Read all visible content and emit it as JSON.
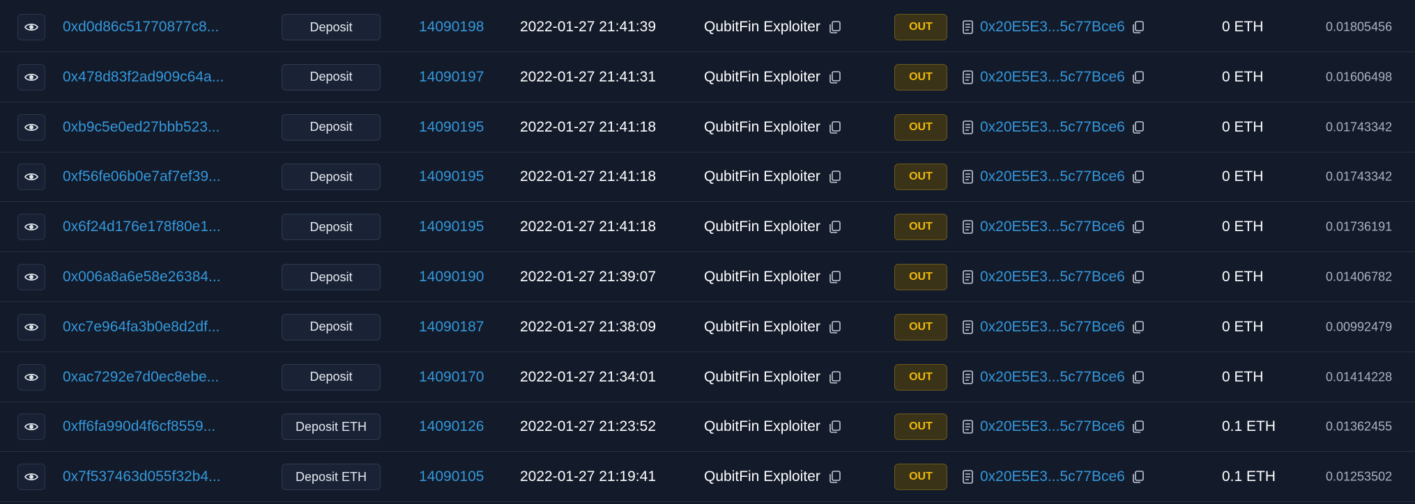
{
  "icons": {
    "view": "eye-icon",
    "copy": "copy-icon",
    "contract": "document-icon"
  },
  "colors": {
    "background": "#131a2a",
    "link": "#3498db",
    "out_badge_text": "#f0b90b",
    "out_badge_bg": "#3a3318"
  },
  "transactions": [
    {
      "hash": "0xd0d86c51770877c8...",
      "method": "Deposit",
      "block": "14090198",
      "age": "2022-01-27 21:41:39",
      "from": "QubitFin Exploiter",
      "direction": "OUT",
      "to": "0x20E5E3...5c77Bce6",
      "value": "0 ETH",
      "fee": "0.01805456"
    },
    {
      "hash": "0x478d83f2ad909c64a...",
      "method": "Deposit",
      "block": "14090197",
      "age": "2022-01-27 21:41:31",
      "from": "QubitFin Exploiter",
      "direction": "OUT",
      "to": "0x20E5E3...5c77Bce6",
      "value": "0 ETH",
      "fee": "0.01606498"
    },
    {
      "hash": "0xb9c5e0ed27bbb523...",
      "method": "Deposit",
      "block": "14090195",
      "age": "2022-01-27 21:41:18",
      "from": "QubitFin Exploiter",
      "direction": "OUT",
      "to": "0x20E5E3...5c77Bce6",
      "value": "0 ETH",
      "fee": "0.01743342"
    },
    {
      "hash": "0xf56fe06b0e7af7ef39...",
      "method": "Deposit",
      "block": "14090195",
      "age": "2022-01-27 21:41:18",
      "from": "QubitFin Exploiter",
      "direction": "OUT",
      "to": "0x20E5E3...5c77Bce6",
      "value": "0 ETH",
      "fee": "0.01743342"
    },
    {
      "hash": "0x6f24d176e178f80e1...",
      "method": "Deposit",
      "block": "14090195",
      "age": "2022-01-27 21:41:18",
      "from": "QubitFin Exploiter",
      "direction": "OUT",
      "to": "0x20E5E3...5c77Bce6",
      "value": "0 ETH",
      "fee": "0.01736191"
    },
    {
      "hash": "0x006a8a6e58e26384...",
      "method": "Deposit",
      "block": "14090190",
      "age": "2022-01-27 21:39:07",
      "from": "QubitFin Exploiter",
      "direction": "OUT",
      "to": "0x20E5E3...5c77Bce6",
      "value": "0 ETH",
      "fee": "0.01406782"
    },
    {
      "hash": "0xc7e964fa3b0e8d2df...",
      "method": "Deposit",
      "block": "14090187",
      "age": "2022-01-27 21:38:09",
      "from": "QubitFin Exploiter",
      "direction": "OUT",
      "to": "0x20E5E3...5c77Bce6",
      "value": "0 ETH",
      "fee": "0.00992479"
    },
    {
      "hash": "0xac7292e7d0ec8ebe...",
      "method": "Deposit",
      "block": "14090170",
      "age": "2022-01-27 21:34:01",
      "from": "QubitFin Exploiter",
      "direction": "OUT",
      "to": "0x20E5E3...5c77Bce6",
      "value": "0 ETH",
      "fee": "0.01414228"
    },
    {
      "hash": "0xff6fa990d4f6cf8559...",
      "method": "Deposit ETH",
      "block": "14090126",
      "age": "2022-01-27 21:23:52",
      "from": "QubitFin Exploiter",
      "direction": "OUT",
      "to": "0x20E5E3...5c77Bce6",
      "value": "0.1 ETH",
      "fee": "0.01362455"
    },
    {
      "hash": "0x7f537463d055f32b4...",
      "method": "Deposit ETH",
      "block": "14090105",
      "age": "2022-01-27 21:19:41",
      "from": "QubitFin Exploiter",
      "direction": "OUT",
      "to": "0x20E5E3...5c77Bce6",
      "value": "0.1 ETH",
      "fee": "0.01253502"
    }
  ]
}
